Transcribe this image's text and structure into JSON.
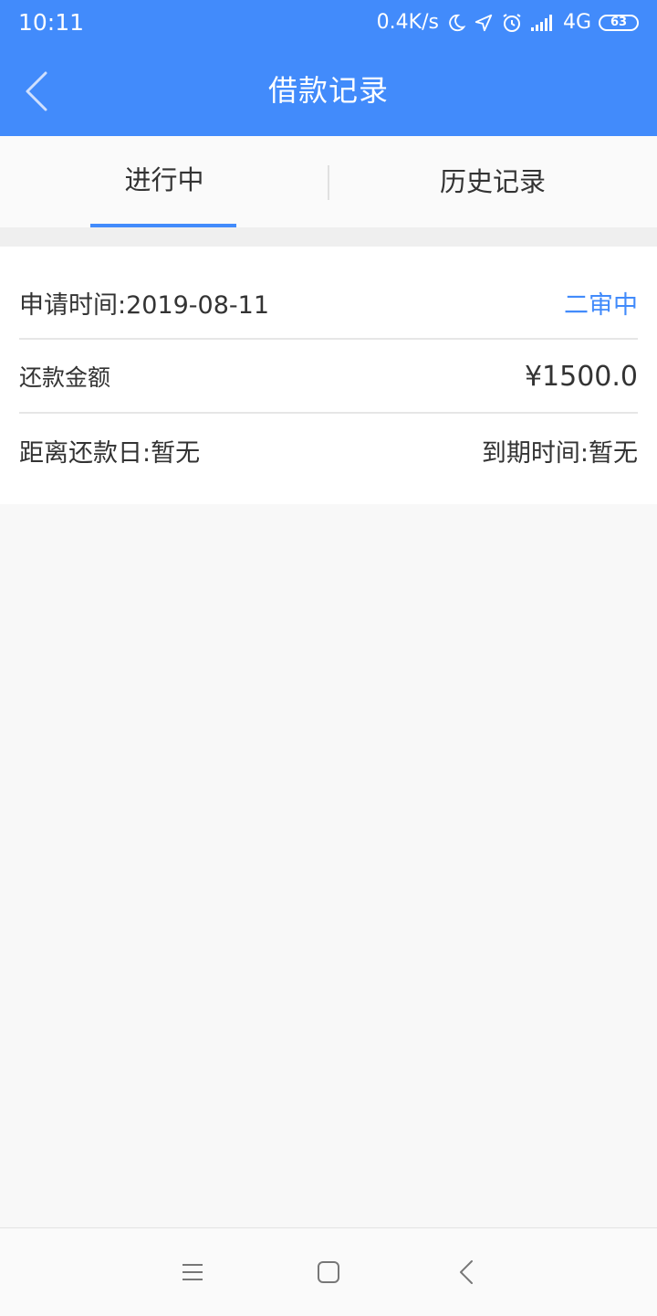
{
  "status_bar": {
    "time": "10:11",
    "net_speed": "0.4K/s",
    "network": "4G",
    "battery": "63"
  },
  "header": {
    "title": "借款记录"
  },
  "tabs": [
    {
      "label": "进行中",
      "active": true
    },
    {
      "label": "历史记录",
      "active": false
    }
  ],
  "record": {
    "apply_time": "申请时间:2019-08-11",
    "status": "二审中",
    "repay_label": "还款金额",
    "repay_amount": "¥1500.0",
    "days_left": "距离还款日:暂无",
    "due_time": "到期时间:暂无"
  },
  "colors": {
    "accent": "#428bfb",
    "background": "#f8f8f8"
  }
}
